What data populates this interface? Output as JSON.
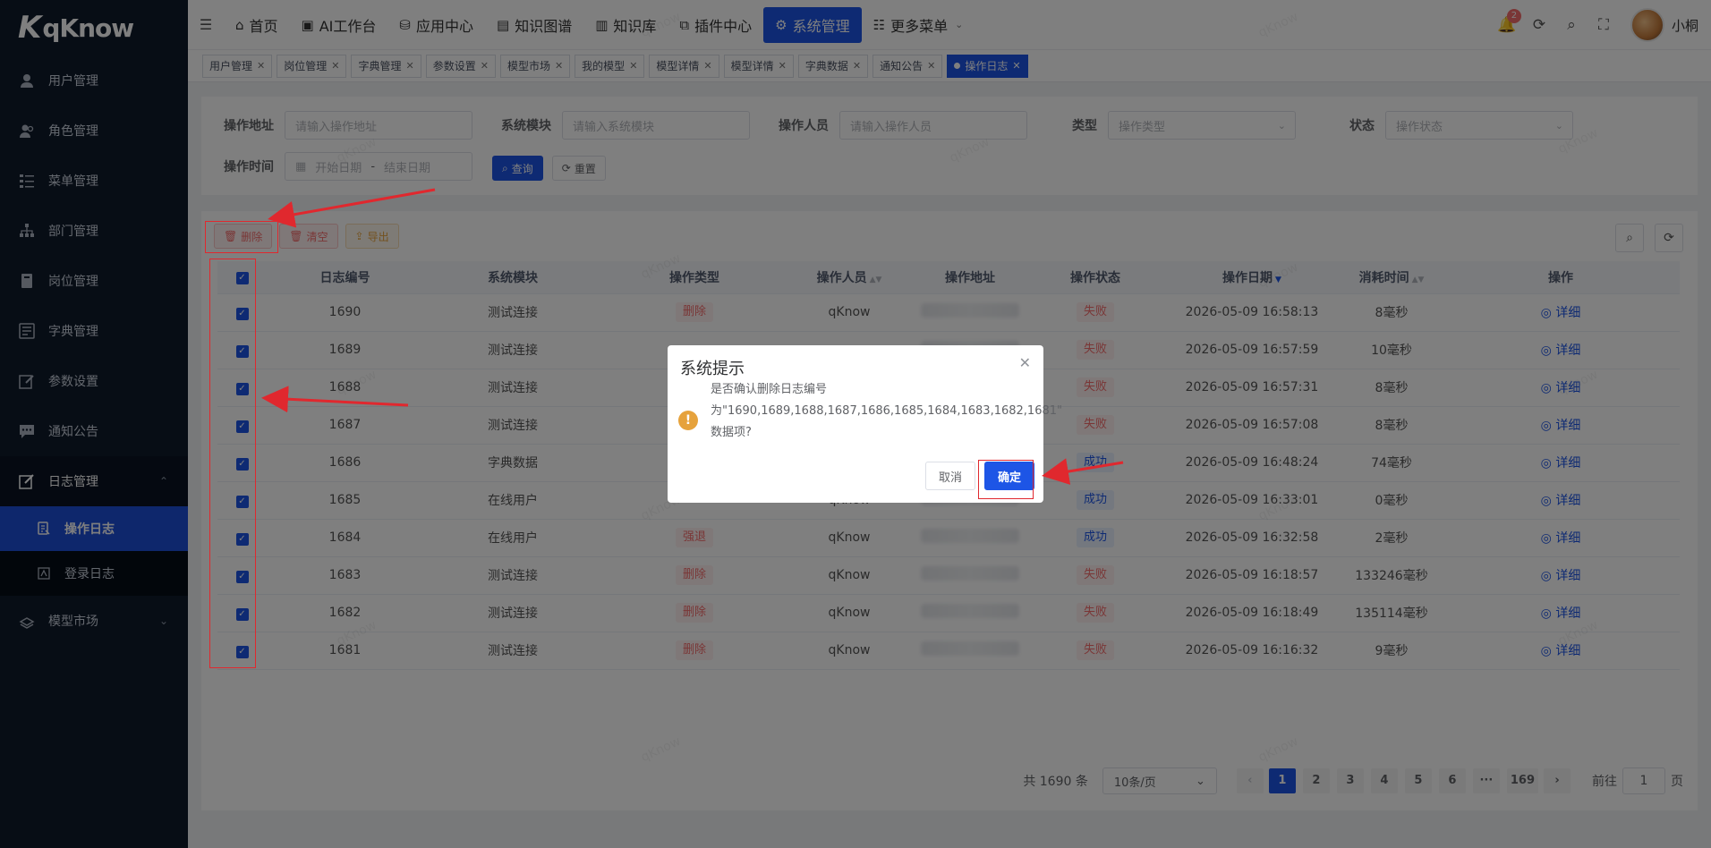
{
  "app": {
    "logo_text": "qKnow"
  },
  "sidebar": {
    "items": [
      {
        "label": "用户管理",
        "icon": "user-icon"
      },
      {
        "label": "角色管理",
        "icon": "role-icon"
      },
      {
        "label": "菜单管理",
        "icon": "menu-icon"
      },
      {
        "label": "部门管理",
        "icon": "dept-icon"
      },
      {
        "label": "岗位管理",
        "icon": "post-icon"
      },
      {
        "label": "字典管理",
        "icon": "dict-icon"
      },
      {
        "label": "参数设置",
        "icon": "edit-icon"
      },
      {
        "label": "通知公告",
        "icon": "message-icon"
      },
      {
        "label": "日志管理",
        "icon": "log-icon"
      }
    ],
    "log_sub": [
      {
        "label": "操作日志"
      },
      {
        "label": "登录日志"
      }
    ],
    "model_market": "模型市场"
  },
  "header": {
    "nav": [
      {
        "label": "首页",
        "icon": "home-icon"
      },
      {
        "label": "AI工作台",
        "icon": "monitor-icon"
      },
      {
        "label": "应用中心",
        "icon": "app-icon"
      },
      {
        "label": "知识图谱",
        "icon": "graph-icon"
      },
      {
        "label": "知识库",
        "icon": "book-icon"
      },
      {
        "label": "插件中心",
        "icon": "plugin-icon"
      },
      {
        "label": "系统管理",
        "icon": "gear-icon"
      },
      {
        "label": "更多菜单",
        "icon": "more-icon"
      }
    ],
    "notification_count": "2",
    "username": "小桐"
  },
  "tags": [
    "用户管理",
    "岗位管理",
    "字典管理",
    "参数设置",
    "模型市场",
    "我的模型",
    "模型详情",
    "模型详情",
    "字典数据",
    "通知公告",
    "操作日志"
  ],
  "search": {
    "op_addr_label": "操作地址",
    "op_addr_ph": "请输入操作地址",
    "module_label": "系统模块",
    "module_ph": "请输入系统模块",
    "operator_label": "操作人员",
    "operator_ph": "请输入操作人员",
    "type_label": "类型",
    "type_ph": "操作类型",
    "status_label": "状态",
    "status_ph": "操作状态",
    "time_label": "操作时间",
    "start_ph": "开始日期",
    "sep": "-",
    "end_ph": "结束日期",
    "query_btn": "查询",
    "reset_btn": "重置"
  },
  "toolbar": {
    "delete": "删除",
    "clear": "清空",
    "export": "导出"
  },
  "table": {
    "headers": [
      "日志编号",
      "系统模块",
      "操作类型",
      "操作人员",
      "操作地址",
      "操作状态",
      "操作日期",
      "消耗时间",
      "操作"
    ],
    "detail_label": "详细",
    "rows": [
      {
        "id": "1690",
        "module": "测试连接",
        "type": "删除",
        "operator": "qKnow",
        "status": "失败",
        "status_kind": "danger",
        "date": "2026-05-09 16:58:13",
        "cost": "8毫秒"
      },
      {
        "id": "1689",
        "module": "测试连接",
        "type": "",
        "operator": "",
        "status": "失败",
        "status_kind": "danger",
        "date": "2026-05-09 16:57:59",
        "cost": "10毫秒"
      },
      {
        "id": "1688",
        "module": "测试连接",
        "type": "",
        "operator": "",
        "status": "失败",
        "status_kind": "danger",
        "date": "2026-05-09 16:57:31",
        "cost": "8毫秒"
      },
      {
        "id": "1687",
        "module": "测试连接",
        "type": "",
        "operator": "",
        "status": "失败",
        "status_kind": "danger",
        "date": "2026-05-09 16:57:08",
        "cost": "8毫秒"
      },
      {
        "id": "1686",
        "module": "字典数据",
        "type": "",
        "operator": "",
        "status": "成功",
        "status_kind": "success",
        "date": "2026-05-09 16:48:24",
        "cost": "74毫秒"
      },
      {
        "id": "1685",
        "module": "在线用户",
        "type": "",
        "operator": "qKnow",
        "status": "成功",
        "status_kind": "success",
        "date": "2026-05-09 16:33:01",
        "cost": "0毫秒"
      },
      {
        "id": "1684",
        "module": "在线用户",
        "type": "强退",
        "operator": "qKnow",
        "status": "成功",
        "status_kind": "success",
        "date": "2026-05-09 16:32:58",
        "cost": "2毫秒"
      },
      {
        "id": "1683",
        "module": "测试连接",
        "type": "删除",
        "operator": "qKnow",
        "status": "失败",
        "status_kind": "danger",
        "date": "2026-05-09 16:18:57",
        "cost": "133246毫秒"
      },
      {
        "id": "1682",
        "module": "测试连接",
        "type": "删除",
        "operator": "qKnow",
        "status": "失败",
        "status_kind": "danger",
        "date": "2026-05-09 16:18:49",
        "cost": "135114毫秒"
      },
      {
        "id": "1681",
        "module": "测试连接",
        "type": "删除",
        "operator": "qKnow",
        "status": "失败",
        "status_kind": "danger",
        "date": "2026-05-09 16:16:32",
        "cost": "9毫秒"
      }
    ]
  },
  "pager": {
    "total": "共 1690 条",
    "size": "10条/页",
    "pages": [
      "1",
      "2",
      "3",
      "4",
      "5",
      "6",
      "···",
      "169"
    ],
    "goto": "前往",
    "page_input": "1",
    "page_unit": "页"
  },
  "dialog": {
    "title": "系统提示",
    "line1": "是否确认删除日志编号",
    "line2": "为\"1690,1689,1688,1687,1686,1685,1684,1683,1682,1681\"",
    "line3": "数据项?",
    "cancel": "取消",
    "confirm": "确定"
  },
  "watermark": "qKnow",
  "colors": {
    "primary": "#1d55e6",
    "sidebar": "#0f1a2b",
    "danger": "#f56c6c",
    "warning": "#e6a23c",
    "annotation": "#e0282e"
  }
}
